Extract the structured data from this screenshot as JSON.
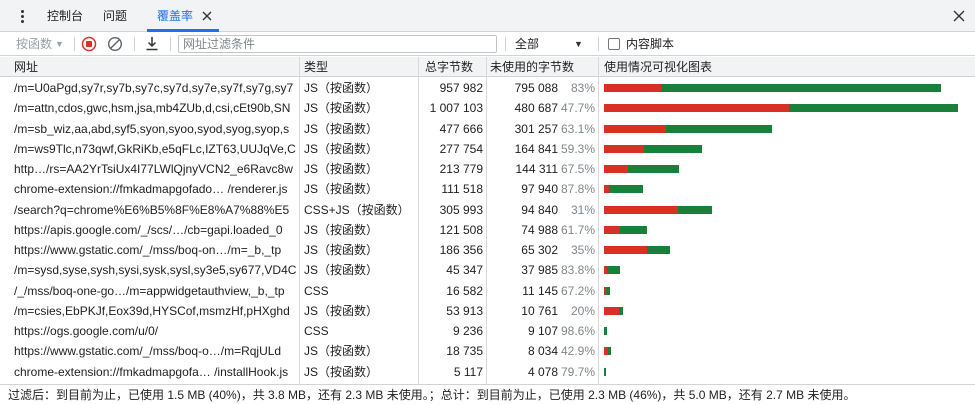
{
  "tabs": [
    {
      "label": "控制台"
    },
    {
      "label": "问题"
    },
    {
      "label": "覆盖率"
    }
  ],
  "toolbar": {
    "mode_label": "按函数",
    "url_filter_placeholder": "网址过滤条件",
    "type_filter_value": "全部",
    "content_scripts_label": "内容脚本"
  },
  "columns": {
    "url": "网址",
    "type": "类型",
    "total": "总字节数",
    "unused": "未使用的字节数",
    "viz": "使用情况可视化图表"
  },
  "colors": {
    "used": "#d93025",
    "unused": "#188038",
    "accent": "#1a73e8"
  },
  "rows": [
    {
      "url": "/m=U0aPgd,sy7r,sy7b,sy7c,sy7d,sy7e,sy7f,sy7g,sy7",
      "type": "JS（按函数）",
      "total": "957 982",
      "unused": "795 088",
      "pct": "83%",
      "total_bytes": 957982,
      "unused_bytes": 795088
    },
    {
      "url": "/m=attn,cdos,gwc,hsm,jsa,mb4ZUb,d,csi,cEt90b,SN",
      "type": "JS（按函数）",
      "total": "1 007 103",
      "unused": "480 687",
      "pct": "47.7%",
      "total_bytes": 1007103,
      "unused_bytes": 480687
    },
    {
      "url": "/m=sb_wiz,aa,abd,syf5,syon,syoo,syod,syog,syop,s",
      "type": "JS（按函数）",
      "total": "477 666",
      "unused": "301 257",
      "pct": "63.1%",
      "total_bytes": 477666,
      "unused_bytes": 301257
    },
    {
      "url": "/m=ws9Tlc,n73qwf,GkRiKb,e5qFLc,IZT63,UUJqVe,C",
      "type": "JS（按函数）",
      "total": "277 754",
      "unused": "164 841",
      "pct": "59.3%",
      "total_bytes": 277754,
      "unused_bytes": 164841
    },
    {
      "url": "http…/rs=AA2YrTsiUx4I77LWlQjnyVCN2_e6Ravc8w",
      "type": "JS（按函数）",
      "total": "213 779",
      "unused": "144 311",
      "pct": "67.5%",
      "total_bytes": 213779,
      "unused_bytes": 144311
    },
    {
      "url": "chrome-extension://fmkadmapgofado… /renderer.js",
      "type": "JS（按函数）",
      "total": "111 518",
      "unused": "97 940",
      "pct": "87.8%",
      "total_bytes": 111518,
      "unused_bytes": 97940
    },
    {
      "url": "/search?q=chrome%E6%B5%8F%E8%A7%88%E5",
      "type": "CSS+JS（按函数）",
      "total": "305 993",
      "unused": "94 840",
      "pct": "31%",
      "total_bytes": 305993,
      "unused_bytes": 94840
    },
    {
      "url": "https://apis.google.com/_/scs/…/cb=gapi.loaded_0",
      "type": "JS（按函数）",
      "total": "121 508",
      "unused": "74 988",
      "pct": "61.7%",
      "total_bytes": 121508,
      "unused_bytes": 74988
    },
    {
      "url": "https://www.gstatic.com/_/mss/boq-on…/m=_b,_tp",
      "type": "JS（按函数）",
      "total": "186 356",
      "unused": "65 302",
      "pct": "35%",
      "total_bytes": 186356,
      "unused_bytes": 65302
    },
    {
      "url": "/m=sysd,syse,sysh,sysi,sysk,sysl,sy3e5,sy677,VD4C",
      "type": "JS（按函数）",
      "total": "45 347",
      "unused": "37 985",
      "pct": "83.8%",
      "total_bytes": 45347,
      "unused_bytes": 37985
    },
    {
      "url": "/_/mss/boq-one-go…/m=appwidgetauthview,_b,_tp",
      "type": "CSS",
      "total": "16 582",
      "unused": "11 145",
      "pct": "67.2%",
      "total_bytes": 16582,
      "unused_bytes": 11145
    },
    {
      "url": "/m=csies,EbPKJf,Eox39d,HYSCof,msmzHf,pHXghd",
      "type": "JS（按函数）",
      "total": "53 913",
      "unused": "10 761",
      "pct": "20%",
      "total_bytes": 53913,
      "unused_bytes": 10761
    },
    {
      "url": "https://ogs.google.com/u/0/",
      "type": "CSS",
      "total": "9 236",
      "unused": "9 107",
      "pct": "98.6%",
      "total_bytes": 9236,
      "unused_bytes": 9107
    },
    {
      "url": "https://www.gstatic.com/_/mss/boq-o…/m=RqjULd",
      "type": "JS（按函数）",
      "total": "18 735",
      "unused": "8 034",
      "pct": "42.9%",
      "total_bytes": 18735,
      "unused_bytes": 8034
    },
    {
      "url": "chrome-extension://fmkadmapgofa… /installHook.js",
      "type": "JS（按函数）",
      "total": "5 117",
      "unused": "4 078",
      "pct": "79.7%",
      "total_bytes": 5117,
      "unused_bytes": 4078
    }
  ],
  "status": {
    "text": "过滤后：到目前为止，已使用 1.5 MB (40%)，共 3.8 MB，还有 2.3 MB 未使用。；总计：到目前为止，已使用 2.3 MB (46%)，共 5.0 MB，还有 2.7 MB 未使用。"
  }
}
